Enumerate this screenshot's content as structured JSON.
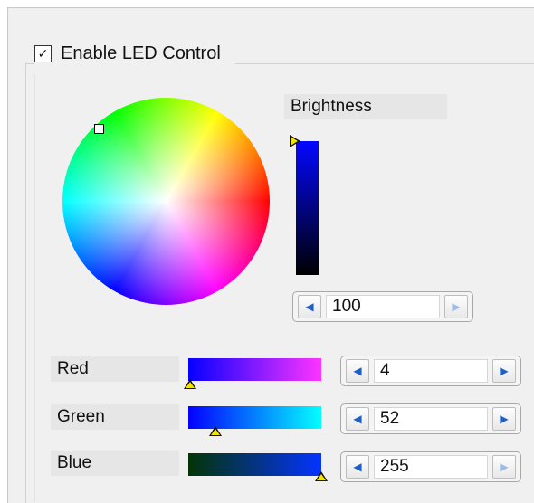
{
  "enable": {
    "label": "Enable LED Control",
    "checked": true,
    "check_glyph": "✓"
  },
  "brightness": {
    "label": "Brightness",
    "value": "100",
    "level_fraction": 1.0,
    "bar_color_top": "#0408ff",
    "bar_color_bottom": "#000000"
  },
  "channels": [
    {
      "label": "Red",
      "value": "4",
      "gradient_from": "#0400ff",
      "gradient_to": "#ff34ff",
      "level_fraction": 0.016
    },
    {
      "label": "Green",
      "value": "52",
      "gradient_from": "#0400ff",
      "gradient_to": "#04ffff",
      "level_fraction": 0.204
    },
    {
      "label": "Blue",
      "value": "255",
      "gradient_from": "#043404",
      "gradient_to": "#0434ff",
      "level_fraction": 1.0
    }
  ],
  "icons": {
    "left_arrow": "◀",
    "right_arrow": "▶"
  },
  "colors": {
    "accent": "#1d5fc4",
    "marker": "#f5e300"
  }
}
